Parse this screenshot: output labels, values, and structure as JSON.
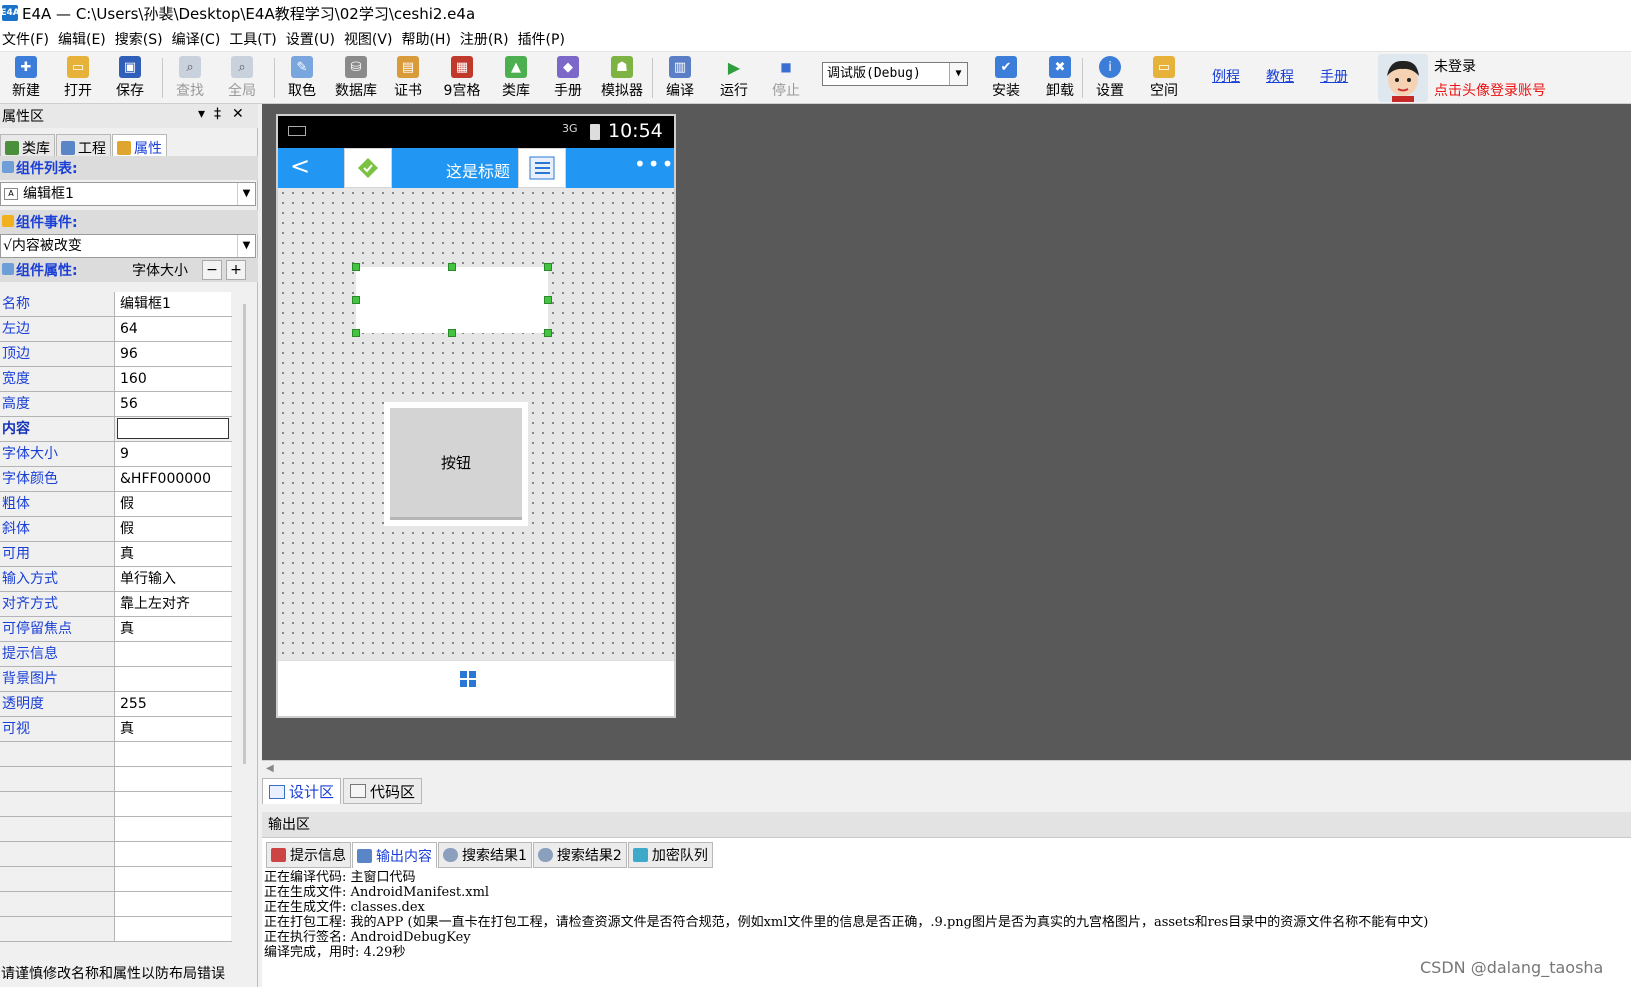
{
  "window": {
    "title": "E4A — C:\\Users\\孙裴\\Desktop\\E4A教程学习\\02学习\\ceshi2.e4a",
    "app_icon_text": "E4A"
  },
  "menu": [
    "文件(F)",
    "编辑(E)",
    "搜索(S)",
    "编译(C)",
    "工具(T)",
    "设置(U)",
    "视图(V)",
    "帮助(H)",
    "注册(R)",
    "插件(P)"
  ],
  "toolbar": {
    "new": "新建",
    "open": "打开",
    "save": "保存",
    "find": "查找",
    "global": "全局",
    "pick_color": "取色",
    "database": "数据库",
    "certificate": "证书",
    "nine_patch": "9宫格",
    "library": "类库",
    "manual": "手册",
    "emulator": "模拟器",
    "compile": "编译",
    "run": "运行",
    "stop": "停止",
    "build_mode": "调试版(Debug)",
    "install": "安装",
    "uninstall": "卸载",
    "settings": "设置",
    "space": "空间",
    "link_examples": "例程",
    "link_tutorial": "教程",
    "link_manual": "手册",
    "user_name": "未登录",
    "login_hint": "点击头像登录账号"
  },
  "left_panel": {
    "title": "属性区",
    "tabs": [
      "类库",
      "工程",
      "属性"
    ],
    "component_list_label": "组件列表:",
    "component_selected": "编辑框1",
    "component_events_label": "组件事件:",
    "event_selected": "√内容被改变",
    "component_props_label": "组件属性:",
    "current_prop": "字体大小",
    "props": [
      {
        "name": "名称",
        "value": "编辑框1"
      },
      {
        "name": "左边",
        "value": "64"
      },
      {
        "name": "顶边",
        "value": "96"
      },
      {
        "name": "宽度",
        "value": "160"
      },
      {
        "name": "高度",
        "value": "56"
      },
      {
        "name": "内容",
        "value": ""
      },
      {
        "name": "字体大小",
        "value": "9"
      },
      {
        "name": "字体颜色",
        "value": "&HFF000000"
      },
      {
        "name": "粗体",
        "value": "假"
      },
      {
        "name": "斜体",
        "value": "假"
      },
      {
        "name": "可用",
        "value": "真"
      },
      {
        "name": "输入方式",
        "value": "单行输入"
      },
      {
        "name": "对齐方式",
        "value": "靠上左对齐"
      },
      {
        "name": "可停留焦点",
        "value": "真"
      },
      {
        "name": "提示信息",
        "value": ""
      },
      {
        "name": "背景图片",
        "value": ""
      },
      {
        "name": "透明度",
        "value": "255"
      },
      {
        "name": "可视",
        "value": "真"
      }
    ],
    "status": "请谨慎修改名称和属性以防布局错误"
  },
  "phone": {
    "time": "10:54",
    "signal": "3G",
    "title": "这是标题",
    "button_label": "按钮"
  },
  "design_tabs": [
    "设计区",
    "代码区"
  ],
  "output": {
    "title": "输出区",
    "tabs": [
      "提示信息",
      "输出内容",
      "搜索结果1",
      "搜索结果2",
      "加密队列"
    ],
    "log": [
      "正在编译代码: 主窗口代码",
      "正在生成文件: AndroidManifest.xml",
      "正在生成文件: classes.dex",
      "正在打包工程: 我的APP (如果一直卡在打包工程，请检查资源文件是否符合规范，例如xml文件里的信息是否正确，.9.png图片是否为真实的九宫格图片，assets和res目录中的资源文件名称不能有中文)",
      "正在执行签名: AndroidDebugKey",
      "编译完成，用时: 4.29秒"
    ]
  },
  "watermark": "CSDN @dalang_taosha",
  "colors": {
    "accent": "#1a3fd6",
    "phone_bar": "#2196f3",
    "design_bg": "#595959",
    "handle": "#43c443",
    "login_hint": "#ee1111"
  }
}
